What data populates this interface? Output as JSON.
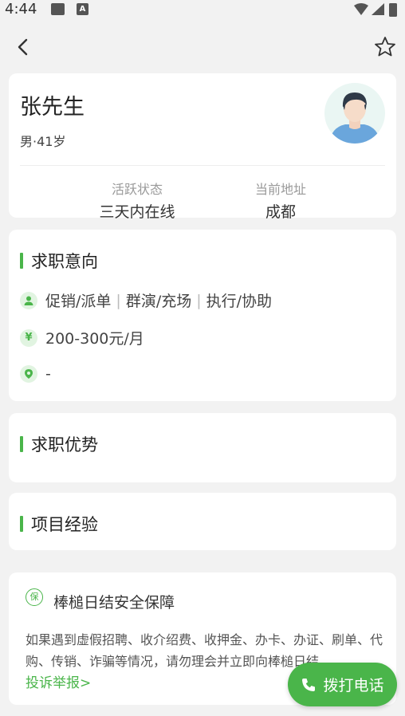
{
  "status_bar": {
    "time": "4:44",
    "a_glyph": "A",
    "battery_glyph": "B"
  },
  "nav": {
    "back_icon": "chevron-left-icon",
    "favorite_icon": "star-outline-icon"
  },
  "profile": {
    "name": "张先生",
    "meta": "男·41岁",
    "stats": [
      {
        "label": "活跃状态",
        "value": "三天内在线"
      },
      {
        "label": "当前地址",
        "value": "成都"
      }
    ]
  },
  "intent": {
    "title": "求职意向",
    "categories": [
      "促销/派单",
      "群演/充场",
      "执行/协助"
    ],
    "salary": "200-300元/月",
    "salary_icon_glyph": "¥",
    "location": "-"
  },
  "advantage": {
    "title": "求职优势"
  },
  "experience": {
    "title": "项目经验"
  },
  "safety": {
    "icon_glyph": "保",
    "title": "棒槌日结安全保障",
    "body": "如果遇到虚假招聘、收介绍费、收押金、办卡、办证、刷单、代购、传销、诈骗等情况，请勿理会并立即向棒槌日结",
    "report_link": "投诉举报>"
  },
  "call_button": {
    "label": "拨打电话"
  },
  "colors": {
    "accent": "#4ab54a",
    "background": "#f2f2f2",
    "card": "#ffffff"
  }
}
